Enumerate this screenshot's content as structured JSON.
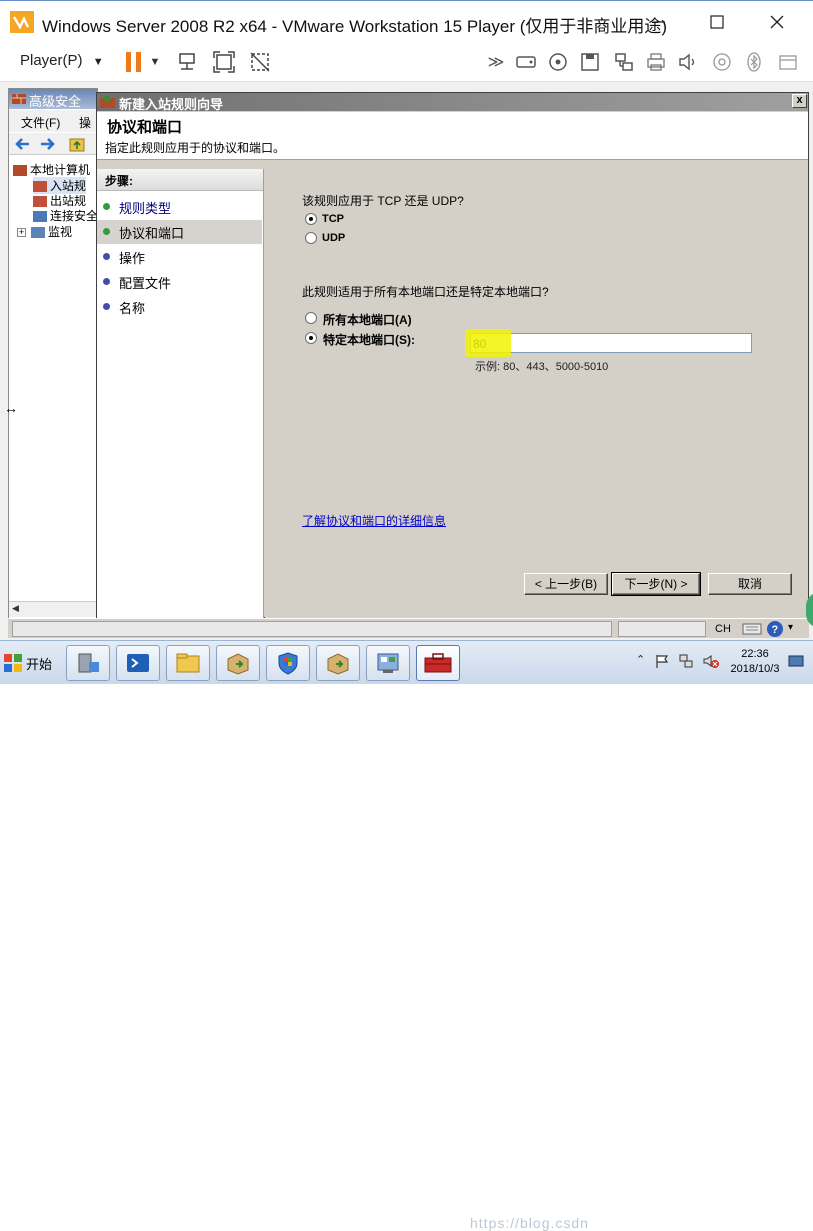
{
  "vmware": {
    "title": "Windows Server 2008 R2 x64 - VMware Workstation 15 Player (仅用于非商业用途)",
    "player_menu": "Player(P)",
    "icons": [
      "pause-icon",
      "send-ctrl-alt-del-icon",
      "fit-guest-icon",
      "unity-icon",
      "forward-icon",
      "hard-disk-icon",
      "cd-dvd-icon",
      "floppy-icon",
      "network-icon",
      "printer-icon",
      "sound-icon",
      "camera-icon",
      "bluetooth-icon",
      "usb-icon"
    ]
  },
  "mmc": {
    "title": "高级安全",
    "menu_file": "文件(F)",
    "menu_action": "操作",
    "tree": [
      "本地计算机",
      "入站规",
      "出站规",
      "连接安全",
      "监视"
    ]
  },
  "dialog": {
    "title": "新建入站规则向导",
    "close": "x",
    "heading": "协议和端口",
    "subheading": "指定此规则应用于的协议和端口。",
    "steps_header": "步骤:",
    "steps": [
      {
        "label": "规则类型",
        "dot": "#2e9e3a",
        "link": true
      },
      {
        "label": "协议和端口",
        "dot": "#2e9e3a",
        "selected": true
      },
      {
        "label": "操作",
        "dot": "#3f4fb0"
      },
      {
        "label": "配置文件",
        "dot": "#3f4fb0"
      },
      {
        "label": "名称",
        "dot": "#3f4fb0"
      }
    ],
    "q1": "该规则应用于 TCP 还是 UDP?",
    "tcp": "TCP",
    "udp": "UDP",
    "q2": "此规则适用于所有本地端口还是特定本地端口?",
    "all_ports": "所有本地端口(A)",
    "specific_ports": "特定本地端口(S):",
    "port_value": "80",
    "example": "示例: 80、443、5000-5010",
    "learn_more": "了解协议和端口的详细信息",
    "back_btn": "< 上一步(B)",
    "next_btn": "下一步(N) >",
    "cancel_btn": "取消"
  },
  "taskbar": {
    "start": "开始",
    "lang": "CH",
    "time": "22:36",
    "date": "2018/10/3",
    "watermark": "https://blog.csdn"
  }
}
